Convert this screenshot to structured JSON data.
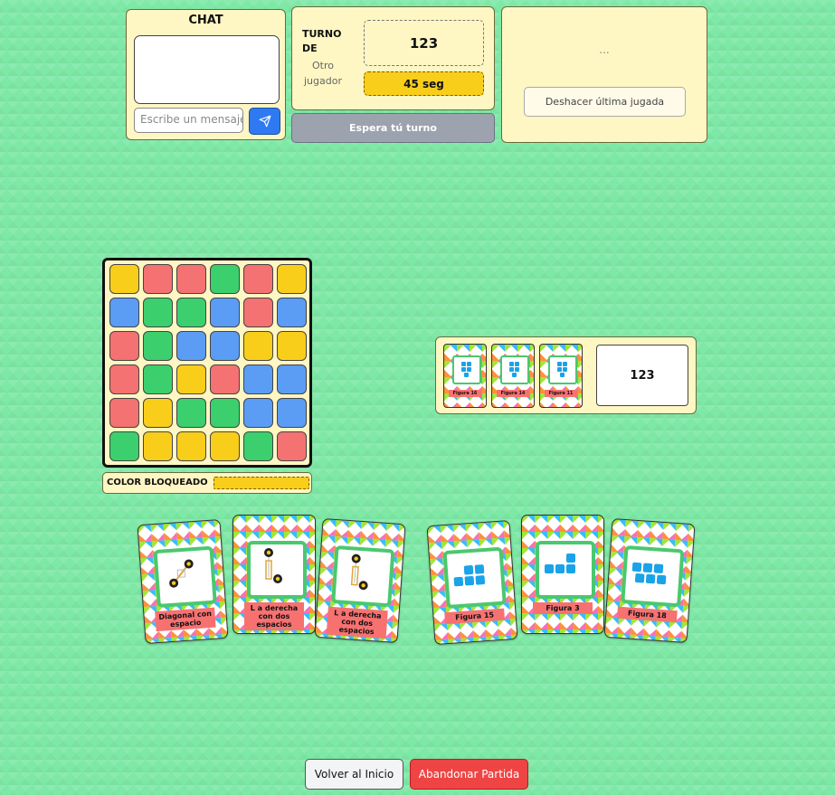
{
  "chat": {
    "title": "CHAT",
    "placeholder": "Escribe un mensaje",
    "send_icon": "send-icon"
  },
  "turn": {
    "label": "TURNO DE",
    "player": "Otro jugador",
    "number": "123",
    "timer": "45 seg",
    "wait_button": "Espera tú turno"
  },
  "info": {
    "status": "...",
    "undo_button": "Deshacer última jugada"
  },
  "colors": {
    "yellow": "#f9ce1b",
    "red": "#f47272",
    "green": "#3ccf6e",
    "blue": "#5b9cf5"
  },
  "board": {
    "grid": [
      [
        "yellow",
        "red",
        "red",
        "green",
        "red",
        "yellow"
      ],
      [
        "blue",
        "green",
        "green",
        "blue",
        "red",
        "blue"
      ],
      [
        "red",
        "green",
        "blue",
        "blue",
        "yellow",
        "yellow"
      ],
      [
        "red",
        "green",
        "yellow",
        "red",
        "blue",
        "blue"
      ],
      [
        "red",
        "yellow",
        "green",
        "green",
        "blue",
        "blue"
      ],
      [
        "green",
        "yellow",
        "yellow",
        "yellow",
        "green",
        "red"
      ]
    ],
    "locked_label": "COLOR BLOQUEADO",
    "locked_color": "yellow"
  },
  "opponent": {
    "mini_cards": [
      {
        "label": "Figura 16"
      },
      {
        "label": "Figura 14"
      },
      {
        "label": "Figura 11"
      }
    ],
    "count": "123"
  },
  "hand": {
    "movement_cards": [
      {
        "label": "Diagonal con espacio",
        "icon": "diagonal-move-icon"
      },
      {
        "label": "L a derecha con dos espacios",
        "icon": "l-move-icon"
      },
      {
        "label": "L a derecha con dos espacios",
        "icon": "l-move-icon"
      }
    ],
    "figure_cards": [
      {
        "label": "Figura 15",
        "icon": "figure-icon"
      },
      {
        "label": "Figura 3",
        "icon": "figure-icon"
      },
      {
        "label": "Figura 18",
        "icon": "figure-icon"
      }
    ]
  },
  "footer": {
    "home_button": "Volver al Inicio",
    "quit_button": "Abandonar Partida"
  }
}
